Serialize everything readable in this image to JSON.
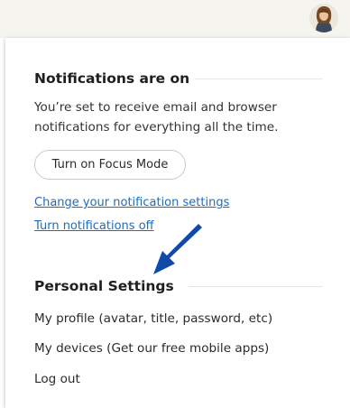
{
  "header": {
    "avatar_icon": "user-avatar-icon"
  },
  "notifications": {
    "title": "Notifications are on",
    "description": "You’re set to receive email and browser notifications for everything all the time.",
    "focus_button_label": "Turn on Focus Mode",
    "change_settings_link": "Change your notification settings",
    "turn_off_link": "Turn notifications off"
  },
  "annotation": {
    "arrow_icon": "arrow-pointer-icon",
    "arrow_color": "#0f4aa8"
  },
  "personal": {
    "title": "Personal Settings",
    "items": [
      {
        "label": "My profile (avatar, title, password, etc)"
      },
      {
        "label": "My devices (Get our free mobile apps)"
      },
      {
        "label": "Log out"
      }
    ]
  },
  "colors": {
    "link": "#1a6cc4",
    "topbar_bg": "#f5f4ef"
  }
}
